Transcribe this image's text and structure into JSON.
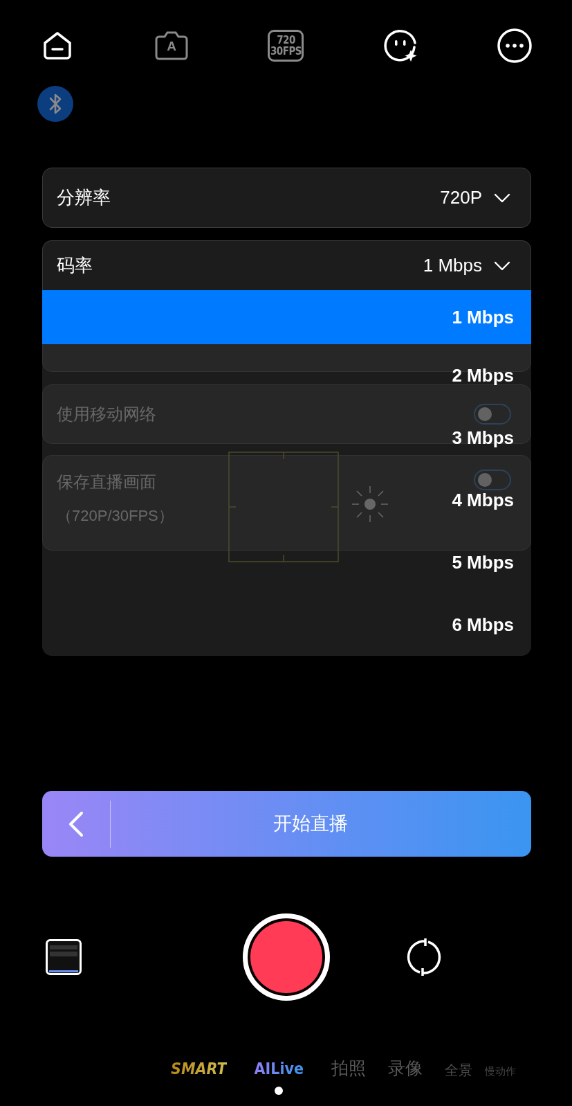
{
  "top_bar": {
    "camera_mode_label": "A",
    "resolution_badge": {
      "line1": "720",
      "line2": "30FPS"
    }
  },
  "settings": {
    "resolution": {
      "label": "分辨率",
      "value": "720P"
    },
    "bitrate": {
      "label": "码率",
      "value": "1 Mbps",
      "expanded": true,
      "options": [
        {
          "label": "1 Mbps",
          "selected": true
        },
        {
          "label": "2 Mbps",
          "selected": false
        },
        {
          "label": "3 Mbps",
          "selected": false
        },
        {
          "label": "4 Mbps",
          "selected": false
        },
        {
          "label": "5 Mbps",
          "selected": false
        },
        {
          "label": "6 Mbps",
          "selected": false
        }
      ]
    },
    "mobile_network": {
      "label": "使用移动网络",
      "on": false
    },
    "save_stream": {
      "label": "保存直播画面",
      "note": "（720P/30FPS）",
      "on": false
    }
  },
  "start_button": {
    "label": "开始直播"
  },
  "modes": [
    {
      "label": "SMART",
      "kind": "smart",
      "selected": false
    },
    {
      "label": "AILive",
      "kind": "ai",
      "selected": true
    },
    {
      "label": "拍照",
      "kind": "plain",
      "selected": false
    },
    {
      "label": "录像",
      "kind": "plain",
      "selected": false
    },
    {
      "label": "全景",
      "kind": "small",
      "selected": false
    },
    {
      "label": "慢动作",
      "kind": "tiny",
      "selected": false
    }
  ]
}
